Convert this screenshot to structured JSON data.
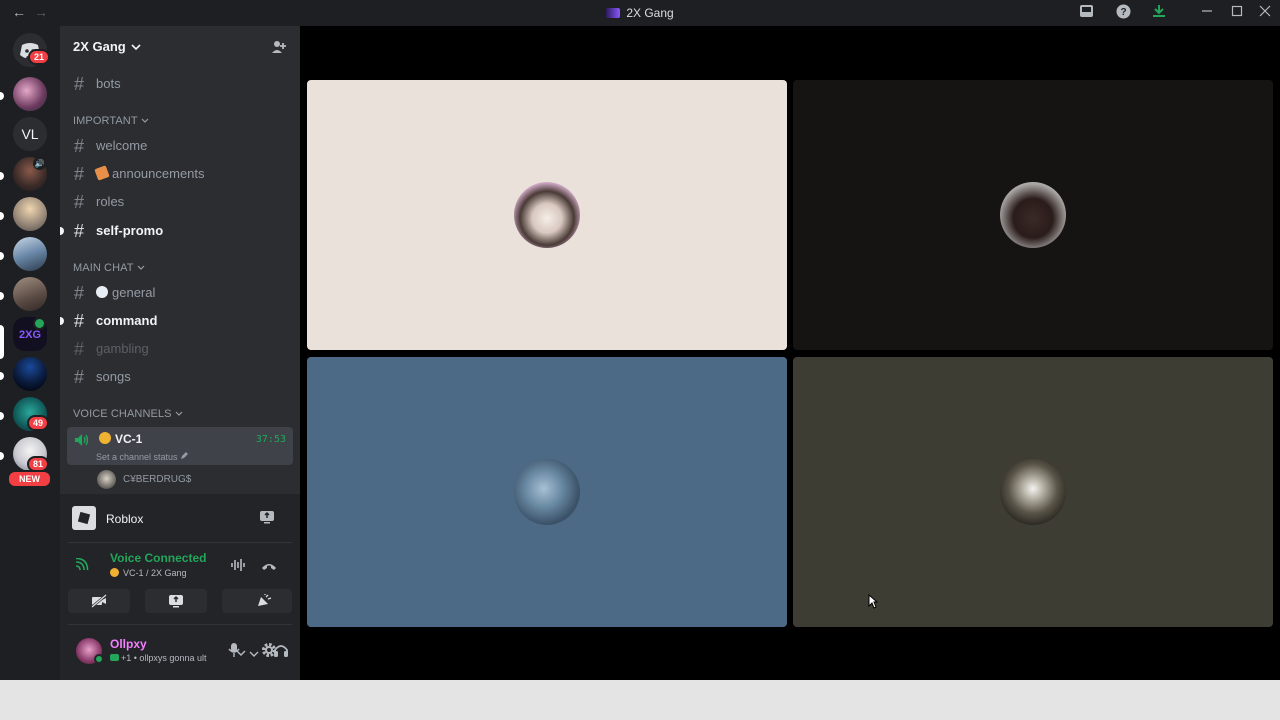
{
  "window": {
    "title": "2X Gang",
    "back_glyph": "←",
    "forward_glyph": "→"
  },
  "titlebar_icons": [
    "inbox-icon",
    "help-icon",
    "download-icon",
    "minimize-icon",
    "maximize-icon",
    "close-icon"
  ],
  "rail": {
    "home_badge": "21",
    "badges": {
      "teal_server": "49",
      "anime_server": "81",
      "new_pill": "NEW"
    },
    "text_server": "VL"
  },
  "server": {
    "name": "2X Gang",
    "channels_top": [
      {
        "label": "bots"
      }
    ],
    "categories": [
      {
        "name": "IMPORTANT",
        "channels": [
          {
            "label": "welcome",
            "state": "normal"
          },
          {
            "label": "announcements",
            "state": "normal",
            "emoji": "loudspeaker"
          },
          {
            "label": "roles",
            "state": "normal"
          },
          {
            "label": "self-promo",
            "state": "unread"
          }
        ]
      },
      {
        "name": "MAIN CHAT",
        "channels": [
          {
            "label": "general",
            "state": "normal",
            "emoji": "speech-bubble"
          },
          {
            "label": "command",
            "state": "unread"
          },
          {
            "label": "gambling",
            "state": "muted"
          },
          {
            "label": "songs",
            "state": "normal"
          }
        ]
      },
      {
        "name": "VOICE CHANNELS",
        "voice": {
          "label": "VC-1",
          "timer": "37:53",
          "status_hint": "Set a channel status",
          "member": "C¥BERDRUG$"
        }
      }
    ]
  },
  "activity": {
    "game": "Roblox",
    "voice_status": "Voice Connected",
    "voice_location": "VC-1 / 2X Gang"
  },
  "user": {
    "name": "Ollpxy",
    "status": "+1 • ollpxys gonna ult"
  },
  "colors": {
    "accent_green": "#23a55a",
    "tile_1": "#e9e1da",
    "tile_2": "#151412",
    "tile_3": "#4c6a85",
    "tile_4": "#3e3d33"
  }
}
